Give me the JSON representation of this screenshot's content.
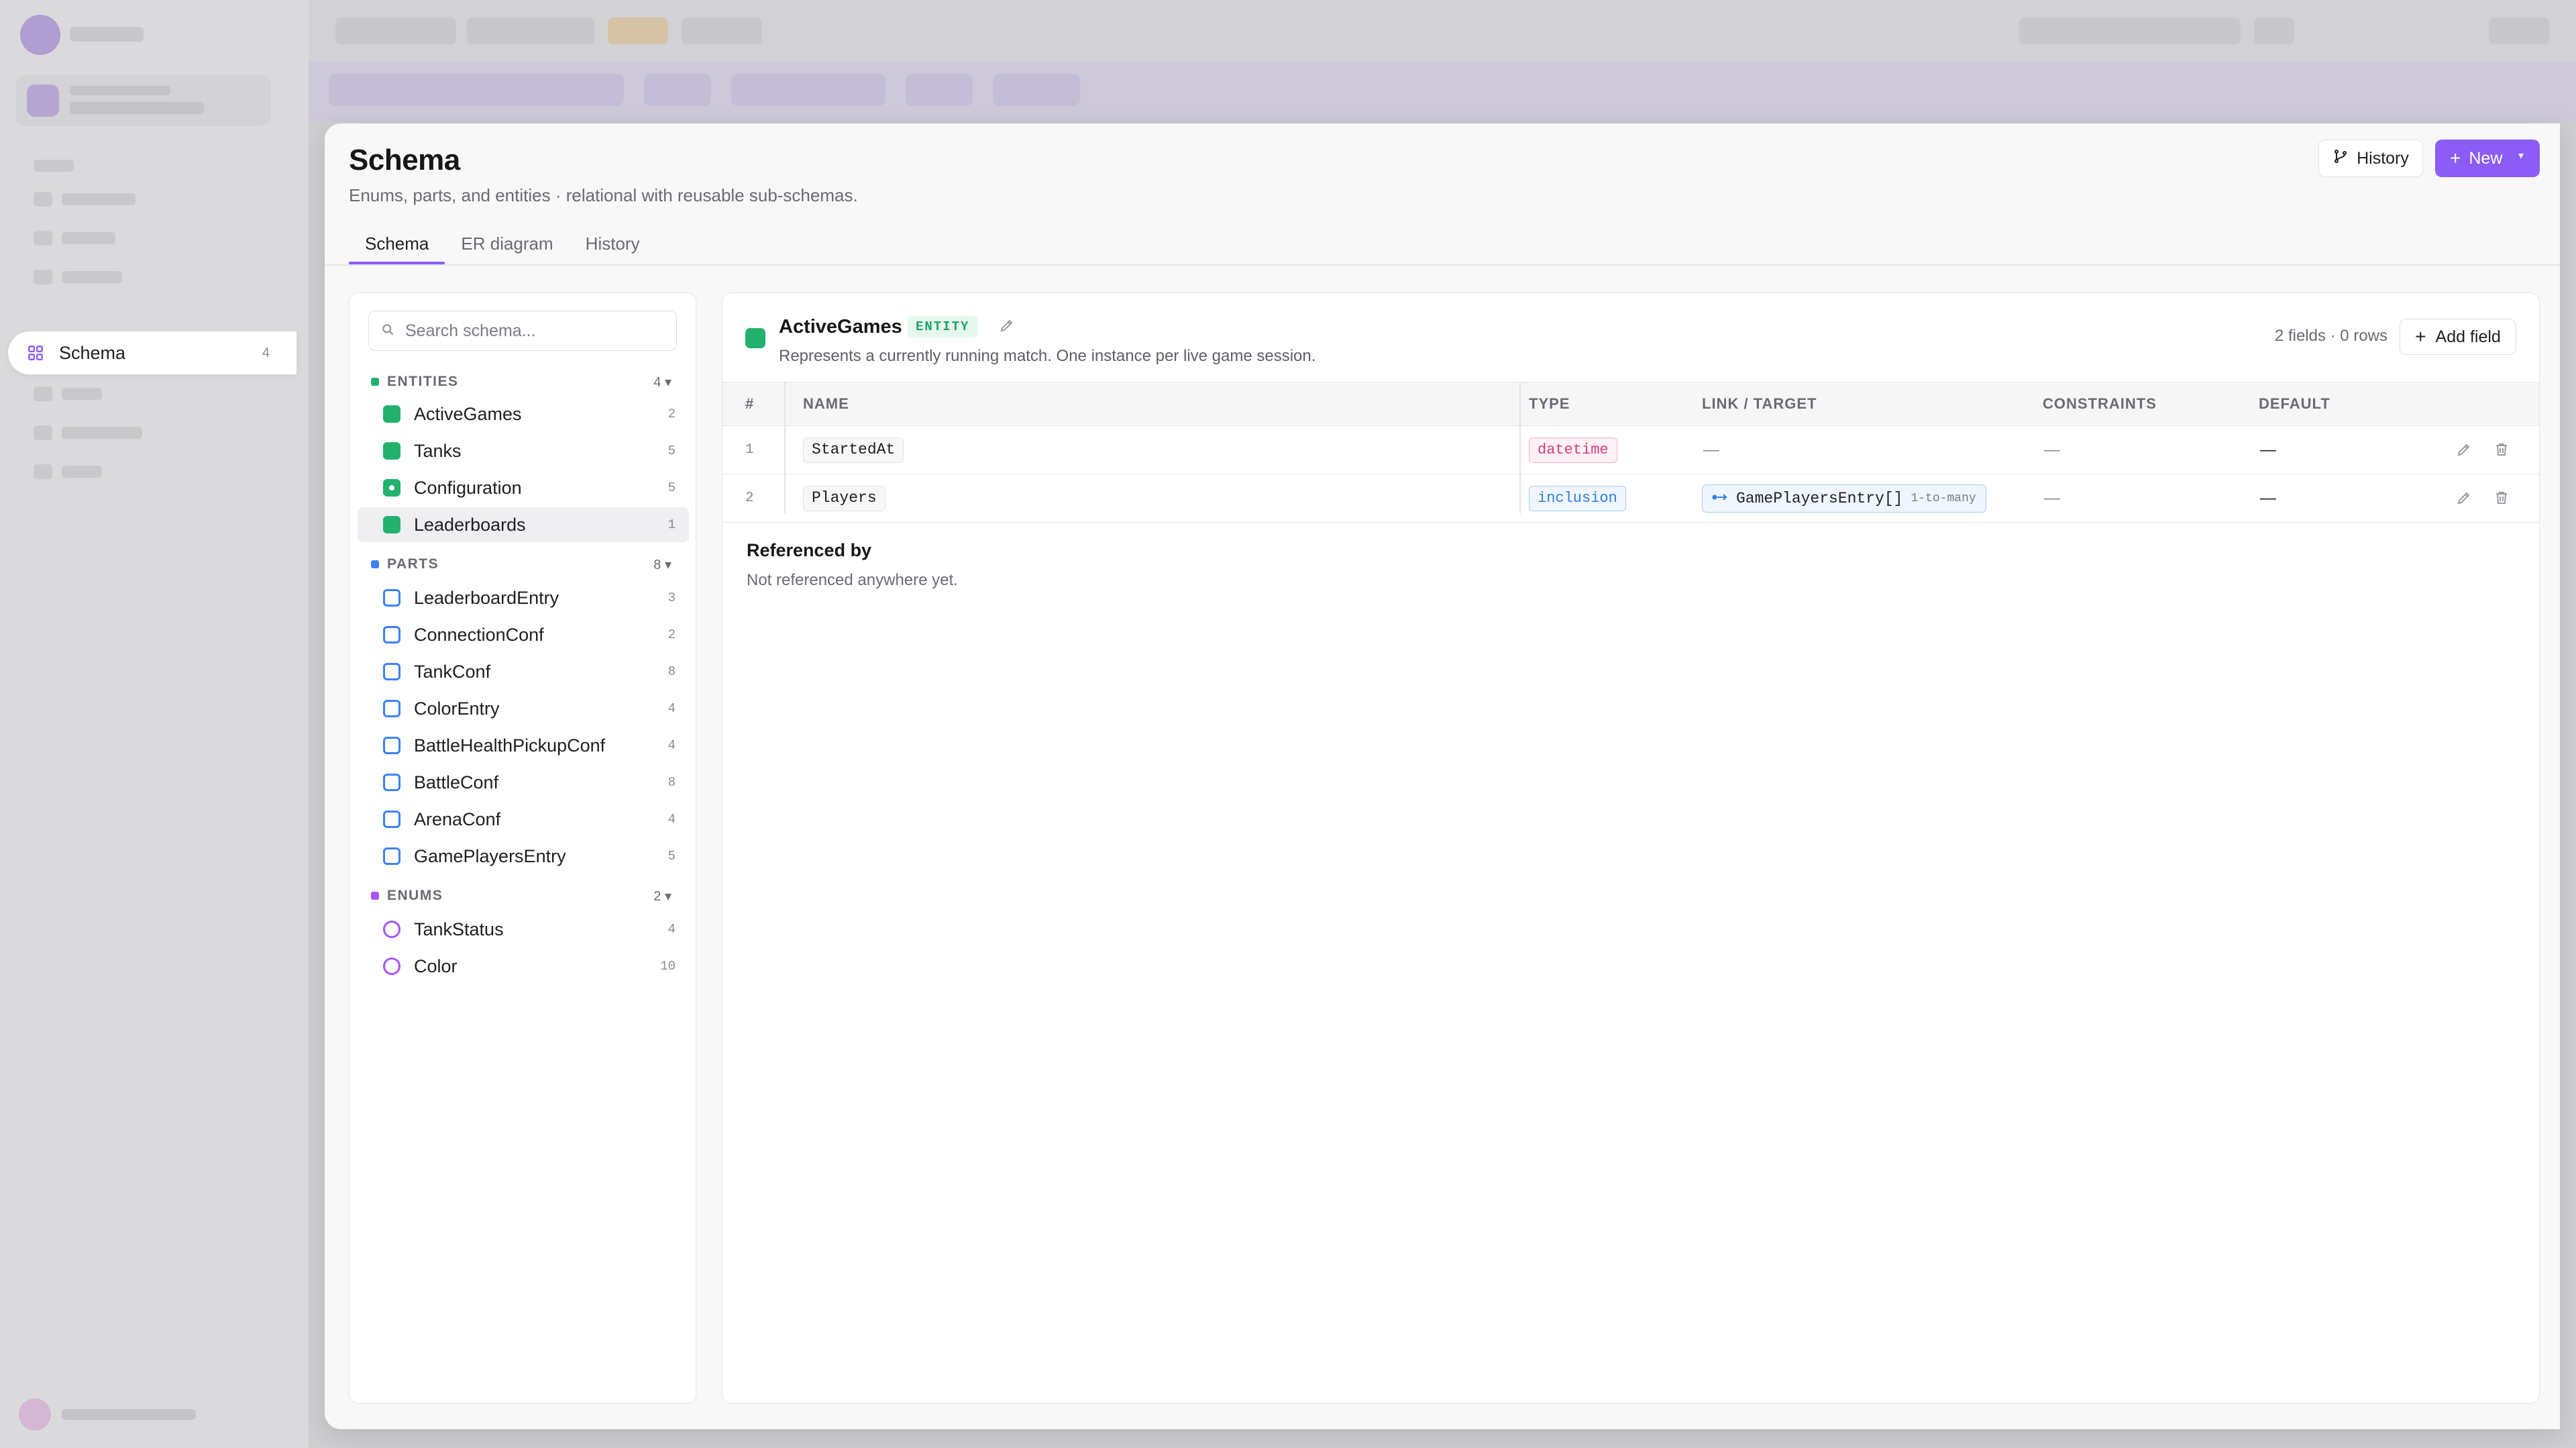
{
  "nav": {
    "schema_label": "Schema",
    "schema_count": "4"
  },
  "page": {
    "title": "Schema",
    "subtitle": "Enums, parts, and entities · relational with reusable sub-schemas.",
    "history_button": "History",
    "new_button": "New",
    "tabs": [
      {
        "label": "Schema",
        "active": true
      },
      {
        "label": "ER diagram",
        "active": false
      },
      {
        "label": "History",
        "active": false
      }
    ]
  },
  "sidebar_list": {
    "search_placeholder": "Search schema...",
    "sections": {
      "entities": {
        "title": "ENTITIES",
        "count": "4",
        "color": "#23b26d",
        "items": [
          {
            "label": "ActiveGames",
            "count": "2"
          },
          {
            "label": "Tanks",
            "count": "5"
          },
          {
            "label": "Configuration",
            "count": "5"
          },
          {
            "label": "Leaderboards",
            "count": "1"
          }
        ]
      },
      "parts": {
        "title": "PARTS",
        "count": "8",
        "color": "#3b82f6",
        "items": [
          {
            "label": "LeaderboardEntry",
            "count": "3"
          },
          {
            "label": "ConnectionConf",
            "count": "2"
          },
          {
            "label": "TankConf",
            "count": "8"
          },
          {
            "label": "ColorEntry",
            "count": "4"
          },
          {
            "label": "BattleHealthPickupConf",
            "count": "4"
          },
          {
            "label": "BattleConf",
            "count": "8"
          },
          {
            "label": "ArenaConf",
            "count": "4"
          },
          {
            "label": "GamePlayersEntry",
            "count": "5"
          }
        ]
      },
      "enums": {
        "title": "ENUMS",
        "count": "2",
        "color": "#a855f7",
        "items": [
          {
            "label": "TankStatus",
            "count": "4"
          },
          {
            "label": "Color",
            "count": "10"
          }
        ]
      }
    }
  },
  "detail": {
    "name": "ActiveGames",
    "badge": "ENTITY",
    "description": "Represents a currently running match. One instance per live game session.",
    "meta": "2 fields · 0 rows",
    "add_field_button": "Add field",
    "columns": {
      "num": "#",
      "name": "NAME",
      "type": "TYPE",
      "link": "LINK / TARGET",
      "constraints": "CONSTRAINTS",
      "default": "DEFAULT"
    },
    "rows": [
      {
        "num": "1",
        "name": "StartedAt",
        "type": "datetime",
        "link": "—",
        "constraints": "—",
        "default": "—"
      },
      {
        "num": "2",
        "name": "Players",
        "type": "inclusion",
        "link_target": "GamePlayersEntry[]",
        "link_rel": "1-to-many",
        "constraints": "—",
        "default": "—"
      }
    ],
    "referenced_by_title": "Referenced by",
    "referenced_by_text": "Not referenced anywhere yet."
  }
}
